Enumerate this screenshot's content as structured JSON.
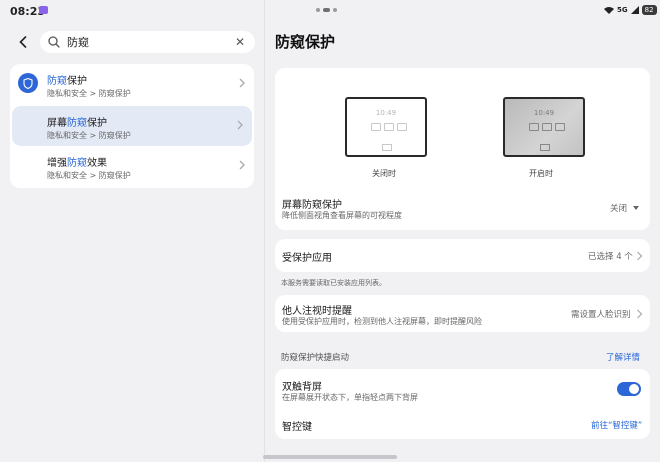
{
  "status": {
    "time": "08:23",
    "signal": "5G",
    "battery": "82"
  },
  "search": {
    "value": "防窥"
  },
  "results": [
    {
      "title_pre": "",
      "title_hl": "防窥",
      "title_post": "保护",
      "path": "隐私和安全 > 防窥保护"
    },
    {
      "title_pre": "屏幕",
      "title_hl": "防窥",
      "title_post": "保护",
      "path": "隐私和安全 > 防窥保护"
    },
    {
      "title_pre": "增强",
      "title_hl": "防窥",
      "title_post": "效果",
      "path": "隐私和安全 > 防窥保护"
    }
  ],
  "page": {
    "title": "防窥保护"
  },
  "preview": {
    "clock": "10:49",
    "off_label": "关闭时",
    "on_label": "开启时"
  },
  "screen_privacy": {
    "title": "屏幕防窥保护",
    "subtitle": "降低侧面视角查看屏幕的可视程度",
    "value": "关闭"
  },
  "protected_apps": {
    "title": "受保护应用",
    "value": "已选择 4 个",
    "note": "本服务需要读取已安装应用列表。"
  },
  "gaze_alert": {
    "title": "他人注视时提醒",
    "subtitle": "使用受保护应用时，检测到他人注视屏幕，即时提醒风险",
    "value": "需设置人脸识别"
  },
  "quick_start": {
    "label": "防窥保护快捷启动",
    "link": "了解详情",
    "double_tap": {
      "title": "双触背屏",
      "subtitle": "在屏幕展开状态下，单指轻点两下背屏",
      "enabled": true
    },
    "smart_key": {
      "title": "智控键",
      "link": "前往“智控键”"
    }
  },
  "colors": {
    "accent": "#2565d8",
    "toggle_on": "#2d66d6",
    "background": "#f1f1f4",
    "card": "#ffffff"
  }
}
